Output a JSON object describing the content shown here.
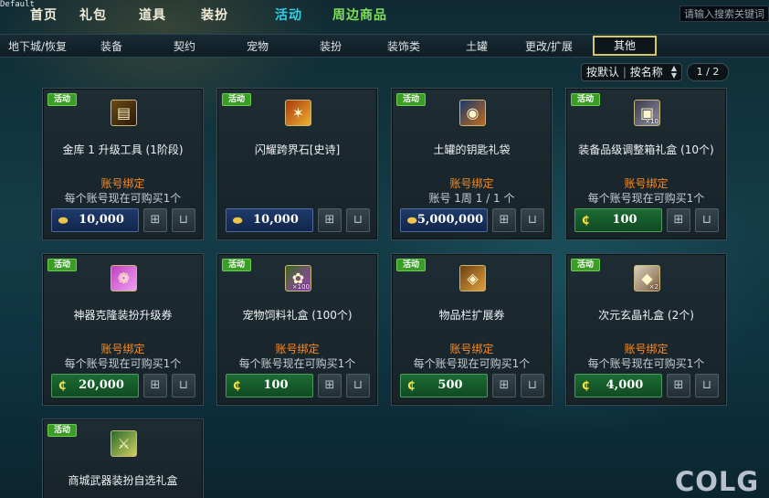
{
  "watermark_default": "Default",
  "topnav": [
    {
      "label": "首页",
      "state": "normal"
    },
    {
      "label": "礼包",
      "state": "normal"
    },
    {
      "label": "道具",
      "state": "normal"
    },
    {
      "label": "装扮",
      "state": "normal"
    },
    {
      "label": "活动",
      "state": "active"
    },
    {
      "label": "周边商品",
      "state": "merch"
    }
  ],
  "search": {
    "placeholder": "请输入搜索关键词"
  },
  "categories": [
    {
      "label": "地下城/恢复"
    },
    {
      "label": "装备"
    },
    {
      "label": "契约"
    },
    {
      "label": "宠物"
    },
    {
      "label": "装扮"
    },
    {
      "label": "装饰类"
    },
    {
      "label": "土罐"
    },
    {
      "label": "更改/扩展"
    },
    {
      "label": "其他",
      "selected": true
    }
  ],
  "sort": {
    "label": "按默认",
    "option": "按名称"
  },
  "pagination": {
    "text": "1 / 2"
  },
  "badge_label": "活动",
  "gift_icon": "gift-icon",
  "cart_icon": "cart-icon",
  "currency_icons": {
    "gold": "gold-coin-icon",
    "cera": "cera-icon"
  },
  "colors": {
    "active_tab": "#2fd0e8",
    "merch_tab": "#7fe05a",
    "bind_text": "#ff8a1e",
    "badge": "#3c9c28",
    "gold_price_bg": "#1f3a6a",
    "cera_price_bg": "#1c6c34"
  },
  "items": [
    {
      "name": "金库 1 升级工具 (1阶段)",
      "icon": "treasure-chest-icon",
      "qty": "",
      "bind": "账号绑定",
      "limit": "每个账号现在可购买1个",
      "currency": "gold",
      "price": "10,000"
    },
    {
      "name": "闪耀跨界石[史诗]",
      "icon": "cross-stone-icon",
      "qty": "",
      "bind": "",
      "limit": "",
      "currency": "gold",
      "price": "10,000"
    },
    {
      "name": "土罐的钥匙礼袋",
      "icon": "key-bag-icon",
      "qty": "",
      "bind": "账号绑定",
      "limit": "账号 1周 1 / 1 个",
      "currency": "gold",
      "price": "5,000,000"
    },
    {
      "name": "装备品级调整箱礼盒 (10个)",
      "icon": "grade-box-icon",
      "qty": "×10",
      "bind": "账号绑定",
      "limit": "每个账号现在可购买1个",
      "currency": "cera",
      "price": "100"
    },
    {
      "name": "神器克隆装扮升级券",
      "icon": "clone-ticket-icon",
      "qty": "",
      "bind": "账号绑定",
      "limit": "每个账号现在可购买1个",
      "currency": "cera",
      "price": "20,000"
    },
    {
      "name": "宠物饲料礼盒 (100个)",
      "icon": "pet-food-icon",
      "qty": "×100",
      "bind": "账号绑定",
      "limit": "每个账号现在可购买1个",
      "currency": "cera",
      "price": "100"
    },
    {
      "name": "物品栏扩展券",
      "icon": "inventory-bag-icon",
      "qty": "",
      "bind": "账号绑定",
      "limit": "每个账号现在可购买1个",
      "currency": "cera",
      "price": "500"
    },
    {
      "name": "次元玄晶礼盒 (2个)",
      "icon": "crystal-box-icon",
      "qty": "×2",
      "bind": "账号绑定",
      "limit": "每个账号现在可购买1个",
      "currency": "cera",
      "price": "4,000"
    },
    {
      "name": "商城武器装扮自选礼盒",
      "icon": "weapon-box-icon",
      "qty": "",
      "bind": "",
      "limit": "",
      "currency": "",
      "price": ""
    }
  ],
  "logo": "COLG"
}
